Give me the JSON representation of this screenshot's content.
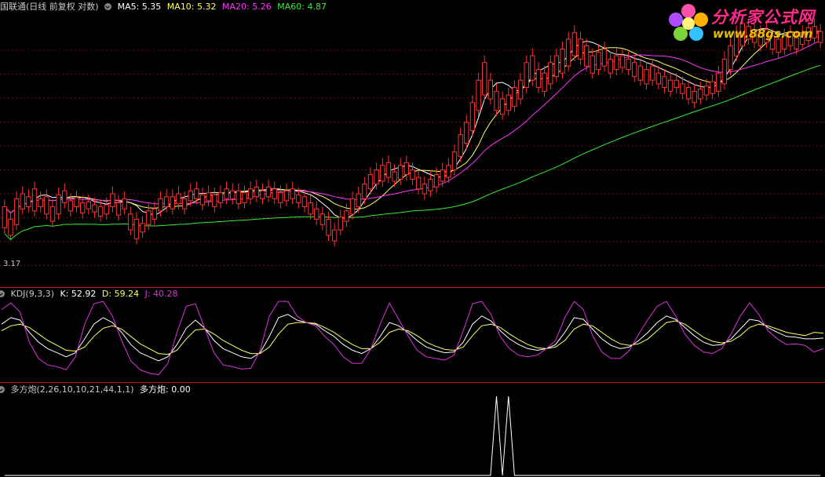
{
  "header": {
    "title": "国联通(日线 前复权 对数)",
    "ma": [
      {
        "label": "MA5: 5.35",
        "color": "#ffffff"
      },
      {
        "label": "MA10: 5.32",
        "color": "#ffff66"
      },
      {
        "label": "MA20: 5.26",
        "color": "#ff33ff"
      },
      {
        "label": "MA60: 4.87",
        "color": "#33ee33"
      }
    ]
  },
  "price_panel": {
    "min_label": "3.17"
  },
  "kdj_panel": {
    "title": "KDJ(9,3,3)",
    "k_label": "K: 52.92",
    "d_label": "D: 59.24",
    "j_label": "J: 40.28"
  },
  "dfp_panel": {
    "title": "多方炮(2,26,10,10,21,44,1,1)",
    "value_label": "多方炮: 0.00"
  },
  "logo": {
    "text": "分析家公式网",
    "url": "www.88gs.com"
  },
  "chart_data": [
    {
      "type": "candlestick",
      "title": "国联通(日线 前复权 对数)",
      "ylim": [
        3.0,
        6.1
      ],
      "min_label": 3.17,
      "candles": [
        [
          3.42,
          3.62
        ],
        [
          3.35,
          3.5
        ],
        [
          3.45,
          3.7
        ],
        [
          3.6,
          3.75
        ],
        [
          3.62,
          3.72
        ],
        [
          3.58,
          3.8
        ],
        [
          3.62,
          3.7
        ],
        [
          3.55,
          3.72
        ],
        [
          3.48,
          3.62
        ],
        [
          3.55,
          3.74
        ],
        [
          3.66,
          3.78
        ],
        [
          3.58,
          3.68
        ],
        [
          3.62,
          3.71
        ],
        [
          3.56,
          3.66
        ],
        [
          3.6,
          3.67
        ],
        [
          3.57,
          3.64
        ],
        [
          3.53,
          3.62
        ],
        [
          3.55,
          3.64
        ],
        [
          3.62,
          3.75
        ],
        [
          3.54,
          3.66
        ],
        [
          3.6,
          3.7
        ],
        [
          3.4,
          3.55
        ],
        [
          3.32,
          3.5
        ],
        [
          3.38,
          3.46
        ],
        [
          3.45,
          3.58
        ],
        [
          3.5,
          3.6
        ],
        [
          3.58,
          3.7
        ],
        [
          3.62,
          3.72
        ],
        [
          3.6,
          3.72
        ],
        [
          3.65,
          3.75
        ],
        [
          3.6,
          3.7
        ],
        [
          3.68,
          3.78
        ],
        [
          3.7,
          3.8
        ],
        [
          3.64,
          3.74
        ],
        [
          3.68,
          3.76
        ],
        [
          3.62,
          3.74
        ],
        [
          3.66,
          3.76
        ],
        [
          3.7,
          3.8
        ],
        [
          3.7,
          3.78
        ],
        [
          3.65,
          3.78
        ],
        [
          3.66,
          3.76
        ],
        [
          3.7,
          3.8
        ],
        [
          3.72,
          3.82
        ],
        [
          3.7,
          3.78
        ],
        [
          3.72,
          3.82
        ],
        [
          3.7,
          3.8
        ],
        [
          3.66,
          3.76
        ],
        [
          3.68,
          3.78
        ],
        [
          3.7,
          3.8
        ],
        [
          3.66,
          3.74
        ],
        [
          3.62,
          3.72
        ],
        [
          3.55,
          3.66
        ],
        [
          3.5,
          3.6
        ],
        [
          3.45,
          3.55
        ],
        [
          3.35,
          3.5
        ],
        [
          3.3,
          3.4
        ],
        [
          3.4,
          3.52
        ],
        [
          3.48,
          3.58
        ],
        [
          3.55,
          3.7
        ],
        [
          3.62,
          3.75
        ],
        [
          3.7,
          3.85
        ],
        [
          3.8,
          3.95
        ],
        [
          3.85,
          4.0
        ],
        [
          3.88,
          4.05
        ],
        [
          3.92,
          4.08
        ],
        [
          3.88,
          3.98
        ],
        [
          3.9,
          4.05
        ],
        [
          3.95,
          4.08
        ],
        [
          3.9,
          4.0
        ],
        [
          3.8,
          3.92
        ],
        [
          3.75,
          3.85
        ],
        [
          3.78,
          3.9
        ],
        [
          3.82,
          3.95
        ],
        [
          3.88,
          4.0
        ],
        [
          3.92,
          4.05
        ],
        [
          4.0,
          4.2
        ],
        [
          4.15,
          4.4
        ],
        [
          4.3,
          4.55
        ],
        [
          4.45,
          4.8
        ],
        [
          4.7,
          5.1
        ],
        [
          4.9,
          5.35
        ],
        [
          4.85,
          5.1
        ],
        [
          4.7,
          4.95
        ],
        [
          4.65,
          4.85
        ],
        [
          4.7,
          4.9
        ],
        [
          4.75,
          5.0
        ],
        [
          4.85,
          5.1
        ],
        [
          5.0,
          5.35
        ],
        [
          5.1,
          5.45
        ],
        [
          5.0,
          5.25
        ],
        [
          4.95,
          5.2
        ],
        [
          5.05,
          5.35
        ],
        [
          5.15,
          5.45
        ],
        [
          5.2,
          5.55
        ],
        [
          5.3,
          5.7
        ],
        [
          5.45,
          5.8
        ],
        [
          5.4,
          5.7
        ],
        [
          5.3,
          5.6
        ],
        [
          5.2,
          5.45
        ],
        [
          5.25,
          5.5
        ],
        [
          5.3,
          5.55
        ],
        [
          5.2,
          5.4
        ],
        [
          5.25,
          5.45
        ],
        [
          5.28,
          5.45
        ],
        [
          5.25,
          5.4
        ],
        [
          5.15,
          5.35
        ],
        [
          5.1,
          5.3
        ],
        [
          5.05,
          5.25
        ],
        [
          5.1,
          5.3
        ],
        [
          5.05,
          5.2
        ],
        [
          5.0,
          5.15
        ],
        [
          4.95,
          5.1
        ],
        [
          5.0,
          5.1
        ],
        [
          4.92,
          5.05
        ],
        [
          4.85,
          5.0
        ],
        [
          4.8,
          4.95
        ],
        [
          4.85,
          4.98
        ],
        [
          4.9,
          5.02
        ],
        [
          4.92,
          5.08
        ],
        [
          4.95,
          5.2
        ],
        [
          5.05,
          5.4
        ],
        [
          5.25,
          5.6
        ],
        [
          5.45,
          5.8
        ],
        [
          5.6,
          5.95
        ],
        [
          5.7,
          5.9
        ],
        [
          5.65,
          5.85
        ],
        [
          5.6,
          5.8
        ],
        [
          5.65,
          5.85
        ],
        [
          5.55,
          5.75
        ],
        [
          5.5,
          5.7
        ],
        [
          5.55,
          5.75
        ],
        [
          5.6,
          5.8
        ],
        [
          5.55,
          5.72
        ],
        [
          5.62,
          5.8
        ],
        [
          5.68,
          5.88
        ],
        [
          5.72,
          5.9
        ],
        [
          5.65,
          5.82
        ]
      ],
      "series": [
        {
          "name": "MA5",
          "color": "#ffffff",
          "last": 5.35
        },
        {
          "name": "MA10",
          "color": "#ffff66",
          "last": 5.32
        },
        {
          "name": "MA20",
          "color": "#ff33ff",
          "last": 5.26
        },
        {
          "name": "MA60",
          "color": "#33ee33",
          "last": 4.87
        }
      ]
    },
    {
      "type": "line",
      "title": "KDJ(9,3,3)",
      "ylim": [
        0,
        100
      ],
      "series": [
        {
          "name": "K",
          "color": "#ffffff",
          "last": 52.92,
          "values": [
            70,
            78,
            75,
            60,
            48,
            40,
            35,
            30,
            35,
            52,
            70,
            78,
            72,
            60,
            45,
            35,
            30,
            25,
            30,
            45,
            65,
            75,
            65,
            50,
            40,
            35,
            30,
            28,
            35,
            55,
            78,
            82,
            75,
            72,
            70,
            62,
            55,
            45,
            38,
            34,
            40,
            55,
            72,
            68,
            60,
            50,
            42,
            38,
            35,
            36,
            48,
            70,
            80,
            74,
            62,
            52,
            45,
            40,
            38,
            40,
            45,
            60,
            78,
            76,
            64,
            52,
            44,
            40,
            42,
            50,
            60,
            72,
            80,
            76,
            66,
            56,
            48,
            44,
            45,
            52,
            64,
            76,
            74,
            66,
            60,
            55,
            54,
            52,
            52,
            53
          ]
        },
        {
          "name": "D",
          "color": "#ffff66",
          "last": 59.24,
          "values": [
            62,
            68,
            70,
            66,
            58,
            50,
            44,
            38,
            37,
            42,
            55,
            65,
            68,
            64,
            55,
            46,
            40,
            34,
            33,
            38,
            52,
            63,
            64,
            58,
            50,
            44,
            38,
            34,
            34,
            42,
            58,
            70,
            72,
            72,
            71,
            66,
            60,
            52,
            45,
            40,
            40,
            48,
            60,
            64,
            62,
            56,
            48,
            43,
            39,
            38,
            42,
            56,
            68,
            70,
            66,
            58,
            51,
            45,
            41,
            40,
            42,
            50,
            64,
            70,
            68,
            60,
            52,
            46,
            44,
            46,
            52,
            62,
            72,
            74,
            70,
            62,
            54,
            49,
            47,
            49,
            56,
            66,
            70,
            68,
            64,
            60,
            58,
            56,
            60,
            59
          ]
        },
        {
          "name": "J",
          "color": "#dd33dd",
          "last": 40.28,
          "values": [
            88,
            96,
            85,
            48,
            28,
            20,
            18,
            14,
            30,
            70,
            95,
            98,
            80,
            50,
            25,
            14,
            10,
            8,
            22,
            60,
            92,
            95,
            65,
            35,
            20,
            18,
            15,
            16,
            38,
            80,
            98,
            98,
            80,
            72,
            68,
            55,
            45,
            30,
            22,
            22,
            40,
            70,
            96,
            76,
            56,
            38,
            30,
            28,
            26,
            32,
            62,
            95,
            98,
            82,
            55,
            40,
            32,
            30,
            32,
            40,
            50,
            78,
            98,
            88,
            56,
            36,
            28,
            28,
            38,
            58,
            76,
            92,
            98,
            80,
            58,
            44,
            36,
            34,
            40,
            58,
            80,
            96,
            82,
            62,
            52,
            45,
            46,
            44,
            36,
            40
          ]
        }
      ]
    },
    {
      "type": "line",
      "title": "多方炮(2,26,10,10,21,44,1,1)",
      "ylim": [
        0,
        1
      ],
      "series": [
        {
          "name": "多方炮",
          "color": "#ffffff",
          "last": 0.0,
          "values": [
            0,
            0,
            0,
            0,
            0,
            0,
            0,
            0,
            0,
            0,
            0,
            0,
            0,
            0,
            0,
            0,
            0,
            0,
            0,
            0,
            0,
            0,
            0,
            0,
            0,
            0,
            0,
            0,
            0,
            0,
            0,
            0,
            0,
            0,
            0,
            0,
            0,
            0,
            0,
            0,
            0,
            0,
            0,
            0,
            0,
            0,
            0,
            0,
            0,
            0,
            0,
            0,
            0,
            0,
            0,
            0,
            0,
            0,
            0,
            0,
            0,
            0,
            0,
            0,
            0,
            0,
            0,
            0,
            0,
            0,
            0,
            0,
            0,
            0,
            0,
            0,
            0,
            0,
            0,
            0,
            0,
            0,
            1,
            0,
            1,
            0,
            0,
            0,
            0,
            0,
            0,
            0,
            0,
            0,
            0,
            0,
            0,
            0,
            0,
            0,
            0,
            0,
            0,
            0,
            0,
            0,
            0,
            0,
            0,
            0,
            0,
            0,
            0,
            0,
            0,
            0,
            0,
            0,
            0,
            0,
            0,
            0,
            0,
            0,
            0,
            0,
            0,
            0,
            0,
            0,
            0,
            0,
            0,
            0,
            0,
            0,
            0
          ]
        }
      ]
    }
  ]
}
